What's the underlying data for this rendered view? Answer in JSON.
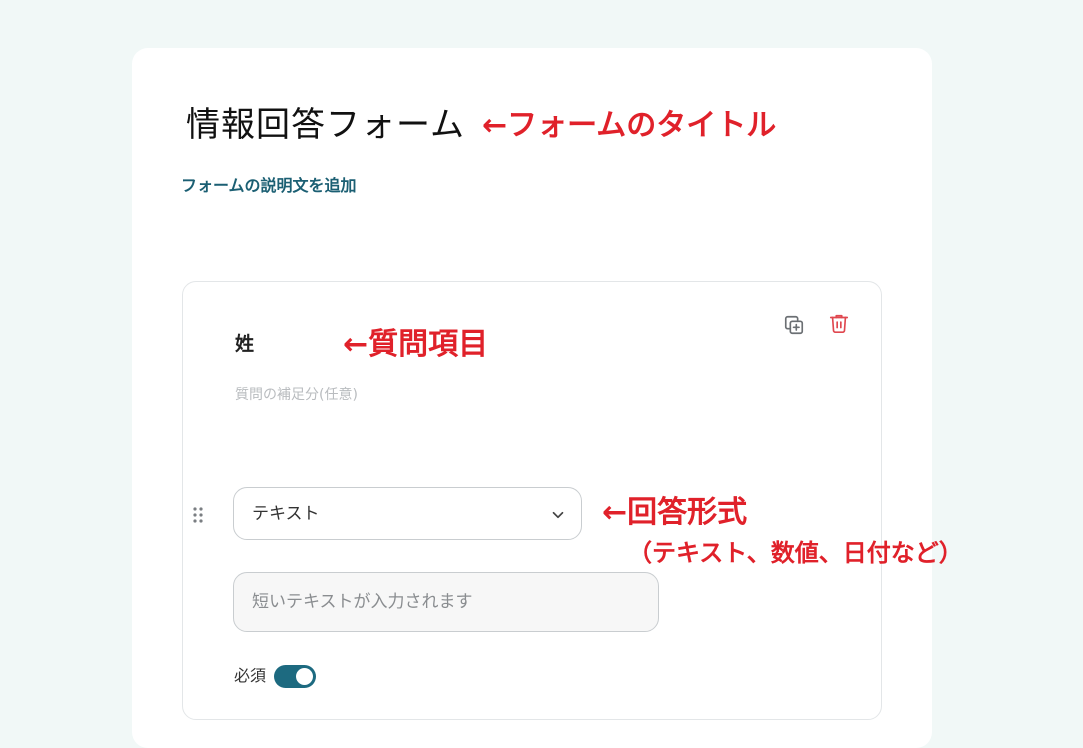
{
  "form": {
    "title": "情報回答フォーム",
    "description_link": "フォームの説明文を追加"
  },
  "question": {
    "title": "姓",
    "subtitle_placeholder": "質問の補足分(任意)",
    "answer_type": "テキスト",
    "answer_placeholder": "短いテキストが入力されます",
    "required_label": "必須",
    "required": true
  },
  "annotations": {
    "title": "←フォームのタイトル",
    "question": "←質問項目",
    "format": "←回答形式",
    "format_examples": "（テキスト、数値、日付など）"
  },
  "colors": {
    "background": "#f1f8f7",
    "accent": "#1d6a80",
    "link": "#1b5f73",
    "annotation": "#e0212a",
    "delete": "#e0474f"
  },
  "icons": {
    "copy": "duplicate-icon",
    "delete": "trash-icon",
    "drag": "drag-handle-icon",
    "dropdown": "chevron-down-icon"
  }
}
